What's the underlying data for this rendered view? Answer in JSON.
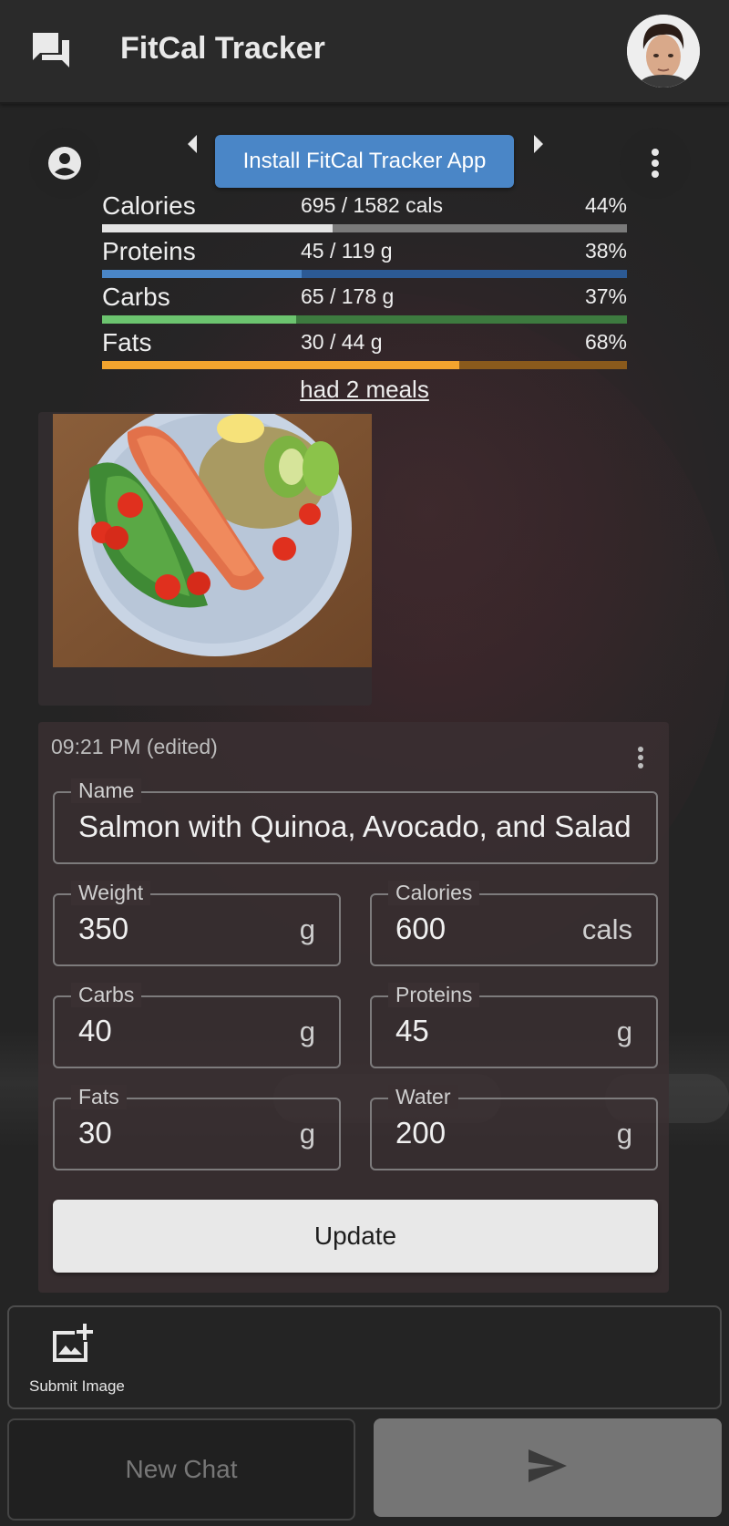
{
  "app": {
    "title": "FitCal Tracker"
  },
  "toolbar": {
    "install_label": "Install FitCal Tracker App"
  },
  "stats": [
    {
      "label": "Calories",
      "value": "695 / 1582 cals",
      "percent": "44%",
      "fraction": 0.44,
      "track_color": "#7a7a7a",
      "fill_color": "#e4e4e4"
    },
    {
      "label": "Proteins",
      "value": "45 / 119 g",
      "percent": "38%",
      "fraction": 0.38,
      "track_color": "#2c5a94",
      "fill_color": "#4a86c7"
    },
    {
      "label": "Carbs",
      "value": "65 / 178 g",
      "percent": "37%",
      "fraction": 0.37,
      "track_color": "#3d7a3f",
      "fill_color": "#6cc46f"
    },
    {
      "label": "Fats",
      "value": "30 / 44 g",
      "percent": "68%",
      "fraction": 0.68,
      "track_color": "#8a5a1c",
      "fill_color": "#f3a42e"
    }
  ],
  "meals_link": "had 2 meals",
  "entry": {
    "timestamp": "09:21 PM (edited)",
    "name": {
      "label": "Name",
      "value": "Salmon with Quinoa, Avocado, and Salad"
    },
    "weight": {
      "label": "Weight",
      "value": "350",
      "unit": "g"
    },
    "calories": {
      "label": "Calories",
      "value": "600",
      "unit": "cals"
    },
    "carbs": {
      "label": "Carbs",
      "value": "40",
      "unit": "g"
    },
    "proteins": {
      "label": "Proteins",
      "value": "45",
      "unit": "g"
    },
    "fats": {
      "label": "Fats",
      "value": "30",
      "unit": "g"
    },
    "water": {
      "label": "Water",
      "value": "200",
      "unit": "g"
    },
    "update_label": "Update"
  },
  "composer": {
    "submit_image_label": "Submit Image",
    "new_chat_label": "New Chat"
  }
}
